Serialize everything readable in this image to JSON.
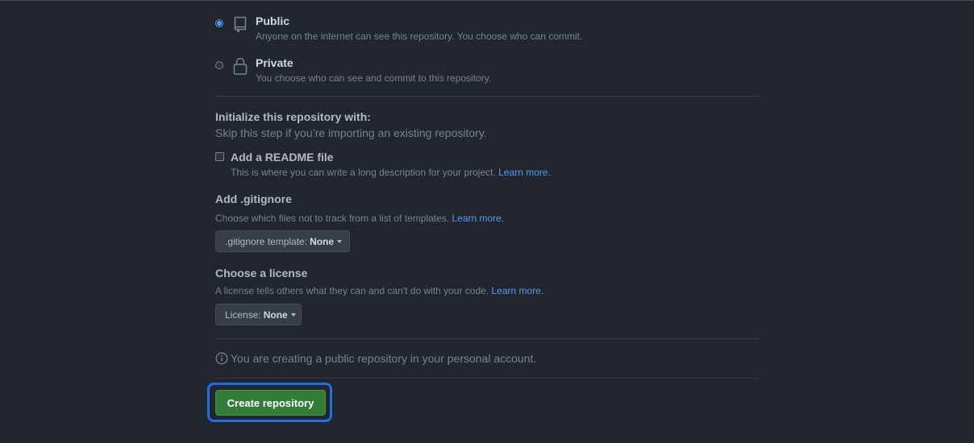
{
  "visibility": {
    "public": {
      "title": "Public",
      "description": "Anyone on the internet can see this repository. You choose who can commit.",
      "checked": true
    },
    "private": {
      "title": "Private",
      "description": "You choose who can see and commit to this repository.",
      "checked": false
    }
  },
  "initialize": {
    "title": "Initialize this repository with:",
    "subtitle": "Skip this step if you’re importing an existing repository.",
    "readme": {
      "label": "Add a README file",
      "description": "This is where you can write a long description for your project.",
      "link": "Learn more.",
      "checked": false
    }
  },
  "gitignore": {
    "title": "Add .gitignore",
    "description": "Choose which files not to track from a list of templates.",
    "link": "Learn more.",
    "select_label": ".gitignore template:",
    "select_value": "None"
  },
  "license": {
    "title": "Choose a license",
    "description": "A license tells others what they can and can't do with your code.",
    "link": "Learn more.",
    "select_label": "License:",
    "select_value": "None"
  },
  "notice": {
    "text": "You are creating a public repository in your personal account."
  },
  "submit": {
    "label": "Create repository"
  },
  "colors": {
    "background": "#22272e",
    "accent": "#539bf5",
    "primary_button": "#347d39",
    "focus": "#1f6feb"
  }
}
